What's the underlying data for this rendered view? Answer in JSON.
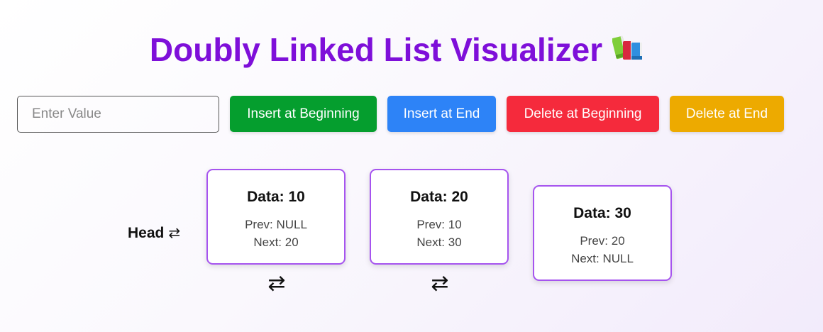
{
  "header": {
    "title": "Doubly Linked List Visualizer",
    "title_color": "#7e0fd9",
    "title_icon": "books-emoji-icon"
  },
  "controls": {
    "input_placeholder": "Enter Value",
    "input_value": "",
    "insert_beginning_label": "Insert at Beginning",
    "insert_end_label": "Insert at End",
    "delete_beginning_label": "Delete at Beginning",
    "delete_end_label": "Delete at End",
    "colors": {
      "insert_beginning": "#059e2e",
      "insert_end": "#2d83f7",
      "delete_beginning": "#f52a3c",
      "delete_end": "#edaa00"
    }
  },
  "list": {
    "head_label": "Head",
    "link_symbol": "⇄",
    "node_border_color": "#a654ef",
    "nodes": [
      {
        "data": "Data: 10",
        "prev": "Prev: NULL",
        "next": "Next: 20"
      },
      {
        "data": "Data: 20",
        "prev": "Prev: 10",
        "next": "Next: 30"
      },
      {
        "data": "Data: 30",
        "prev": "Prev: 20",
        "next": "Next: NULL"
      }
    ]
  }
}
